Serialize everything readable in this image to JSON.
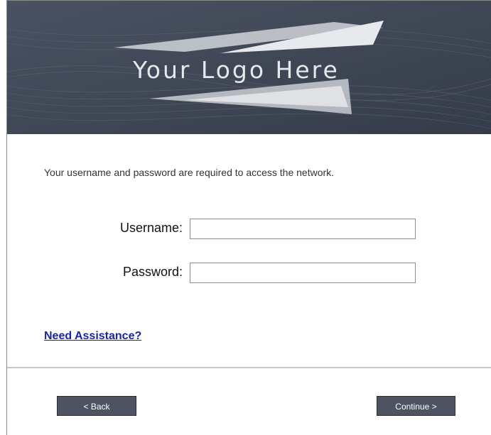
{
  "header": {
    "logo_text": "Your Logo Here",
    "background_color": "#3f4756"
  },
  "form": {
    "intro_text": "Your username and password are required to access the network.",
    "username_label": "Username:",
    "username_value": "",
    "password_label": "Password:",
    "password_value": ""
  },
  "help": {
    "link_text": "Need Assistance?"
  },
  "footer": {
    "back_label": "< Back",
    "continue_label": "Continue >"
  }
}
